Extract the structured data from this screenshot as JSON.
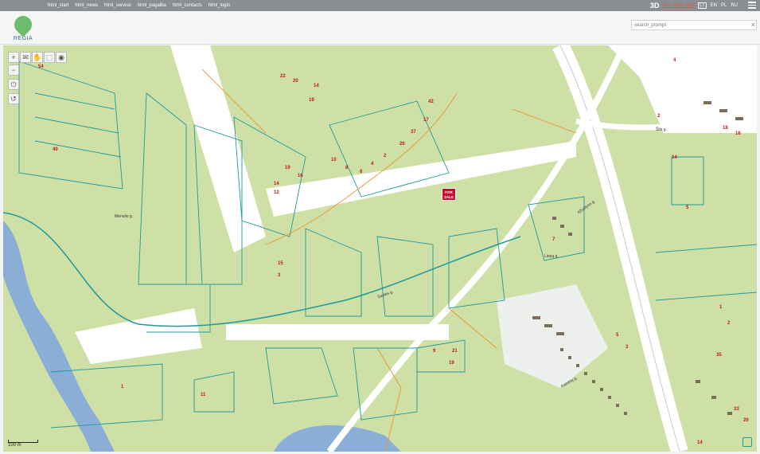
{
  "topnav": {
    "items": [
      "html_start",
      "html_news",
      "html_service",
      "html_pagalba",
      "html_contacts",
      "html_login"
    ]
  },
  "topright": {
    "btn3d": "3D",
    "link": "link_regia_sen",
    "languages": [
      "LT",
      "EN",
      "PL",
      "RU"
    ],
    "active_language": "LT"
  },
  "logo": {
    "text": "REGIA"
  },
  "search": {
    "placeholder": "search_prompt",
    "clear": "×"
  },
  "map": {
    "tools": [
      "+",
      "✉",
      "✋",
      "⬚",
      "◉"
    ],
    "vtools": [
      "−",
      "⏻",
      "↺"
    ],
    "scale": "100 m",
    "forsale": {
      "line1": "FOR",
      "line2": "SALE"
    },
    "streets": [
      "Mėnulio g.",
      "Saulės g.",
      "Liepų g.",
      "Šilo g.",
      "Ąžuolyno g.",
      "Kairėnų g."
    ],
    "plot_numbers": [
      "54",
      "22",
      "20",
      "14",
      "19",
      "42",
      "4",
      "2",
      "14",
      "5",
      "40",
      "19",
      "16",
      "14",
      "12",
      "10",
      "8",
      "6",
      "4",
      "2",
      "26",
      "37",
      "17",
      "15",
      "3",
      "1",
      "11",
      "9",
      "21",
      "19",
      "7",
      "5",
      "3",
      "1",
      "2",
      "35",
      "33",
      "20",
      "18",
      "16",
      "14"
    ]
  },
  "colors": {
    "green": "#cfe0a7",
    "road": "#ffffff",
    "parcel": "#1d9b98",
    "river": "#8aaed6",
    "building": "#7a6e58",
    "forsale": "#c8102e",
    "topbar": "#8a8e92"
  }
}
